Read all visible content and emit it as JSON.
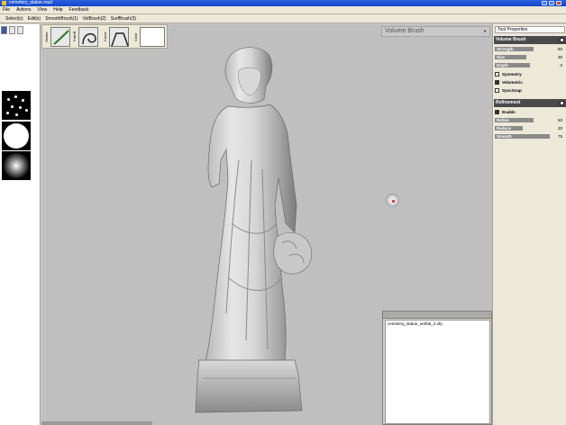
{
  "window": {
    "title": "cemetery_statue.mud"
  },
  "menu": {
    "items": [
      "File",
      "Actions",
      "View",
      "Help",
      "Feedback"
    ]
  },
  "toolbar": {
    "tabs": [
      "Select(s)",
      "Edit(s)",
      "SmoothBrush(1)",
      "VolBrush(2)",
      "SurfBrush(3)"
    ]
  },
  "brush_strip": {
    "labels": [
      "Stroke",
      "Falloff",
      "Curve",
      "Color"
    ]
  },
  "viewport": {
    "brush_dropdown": "Volume Brush"
  },
  "file_panel": {
    "files": [
      "cemetery_statue_netfab_2.obj"
    ]
  },
  "right_panel": {
    "title": "Tool Properties",
    "volume_brush": {
      "header": "Volume Brush",
      "strength": {
        "label": "Strength",
        "value": "50",
        "fraction": 0.55
      },
      "size": {
        "label": "Size",
        "value": "30",
        "fraction": 0.45
      },
      "depth": {
        "label": "Depth",
        "value": "0",
        "fraction": 0.5
      },
      "symmetry": {
        "label": "Symmetry",
        "checked": false
      },
      "volumetric": {
        "label": "Volumetric",
        "checked": true
      },
      "syncsnap": {
        "label": "SyncSnap",
        "checked": false
      }
    },
    "refinement": {
      "header": "Refinement",
      "enable": {
        "label": "Enable",
        "checked": true
      },
      "refine": {
        "label": "Refine",
        "value": "50",
        "fraction": 0.55
      },
      "reduce": {
        "label": "Reduce",
        "value": "20",
        "fraction": 0.4
      },
      "smooth": {
        "label": "Smooth",
        "value": "75",
        "fraction": 0.78
      }
    }
  },
  "colors": {
    "accent": "#2a62e0",
    "viewport_bg": "#bfbfbf",
    "section_bg": "#4a4a4a"
  }
}
